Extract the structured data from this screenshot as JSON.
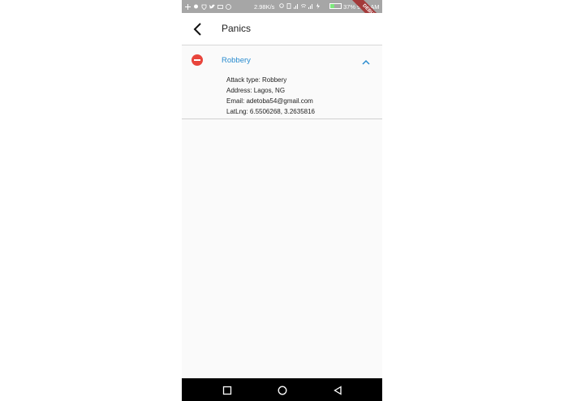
{
  "status_bar": {
    "speed": "2.98K/s",
    "battery": "37%",
    "time": "9:26 AM",
    "battery_level": 0.37,
    "debug_banner": "DEBUG"
  },
  "app_bar": {
    "title": "Panics"
  },
  "panic": {
    "title": "Robbery",
    "details": [
      "Attack type: Robbery",
      "Address: Lagos, NG",
      "Email: adetoba54@gmail.com",
      "LatLng: 6.5506268, 3.2635816"
    ]
  },
  "colors": {
    "accent": "#2a8ccf",
    "remove": "#e8453c",
    "status_bar": "#a6a6a6"
  },
  "icons": {
    "back": "arrow-back-icon",
    "remove": "remove-circle-icon",
    "expand": "chevron-up-icon",
    "nav": [
      "square-icon",
      "circle-icon",
      "triangle-back-icon"
    ]
  }
}
